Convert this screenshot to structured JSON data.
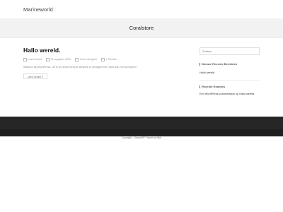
{
  "header": {
    "site_title": "Marineworld"
  },
  "banner": {
    "title": "Coralstore"
  },
  "post": {
    "title": "Hallo wereld.",
    "meta": {
      "author": "marineworld",
      "date": "21 augustus 2020",
      "category": "Geen categorie",
      "replies": "1 Reactie"
    },
    "excerpt": "Welkom bij WordPress. Dit is je eerste bericht. Bewerk of verwijder het, start dan met schrijven!",
    "read_more_label": "Lees Verder »"
  },
  "sidebar": {
    "search_placeholder": "Zoeken",
    "recent_posts_title": "Nieuwe Recente Berichten",
    "recent_posts": [
      "Hallo wereld."
    ],
    "recent_comments_title": "Recente Reacties",
    "recent_comment_author": "Een WordPress-commentator",
    "recent_comment_on": "op",
    "recent_comment_post": "Hallo wereld."
  },
  "footer": {
    "copyright": "Copyright - OceanWP Theme by Nick"
  },
  "colors": {
    "accent": "#c0392b",
    "footer": "#262626",
    "banner": "#f2f2f2"
  }
}
